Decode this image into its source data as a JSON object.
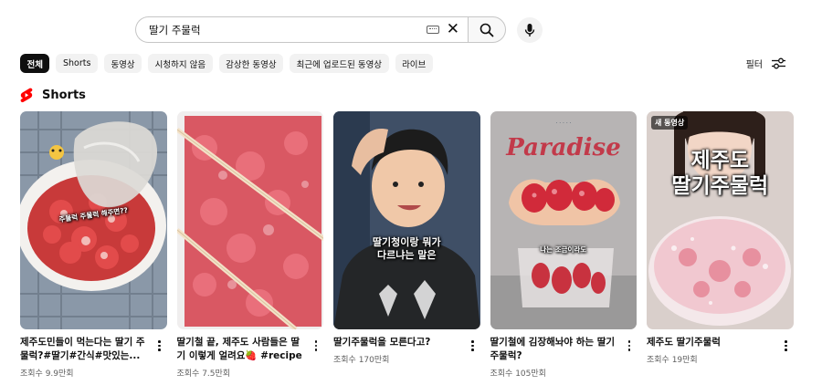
{
  "search": {
    "query": "딸기 주물럭",
    "icons": [
      "keyboard-icon",
      "clear-icon",
      "search-icon",
      "mic-icon"
    ]
  },
  "chips": [
    "전체",
    "Shorts",
    "동영상",
    "시청하지 않음",
    "감상한 동영상",
    "최근에 업로드된 동영상",
    "라이브"
  ],
  "active_chip": "전체",
  "filter_label": "필터",
  "shorts_section": {
    "title": "Shorts",
    "brand_color": "#ff0000"
  },
  "cards": [
    {
      "title": "제주도민들이 먹는다는 딸기 주물럭?#딸기#간식#맛있는...",
      "views": "조회수 9.9만회",
      "caption": "주물럭 주물럭 해주면??"
    },
    {
      "title": "딸기철 끝, 제주도 사람들은 딸기 이렇게 얼려요🍓 #recipe",
      "views": "조회수 7.5만회",
      "caption": ""
    },
    {
      "title": "딸기주물럭을 모른다고?",
      "views": "조회수 170만회",
      "caption": "딸기청이랑 뭐가\n다르냐는 말은"
    },
    {
      "title": "딸기철에 김장해놔야 하는 딸기 주물럭?",
      "views": "조회수 105만회",
      "caption": "나는 조금이라도",
      "shirt_text": "Paradise"
    },
    {
      "title": "제주도 딸기주물럭",
      "views": "조회수 19만회",
      "caption": "제주도\n딸기주물럭",
      "badge": "새 동영상"
    }
  ]
}
